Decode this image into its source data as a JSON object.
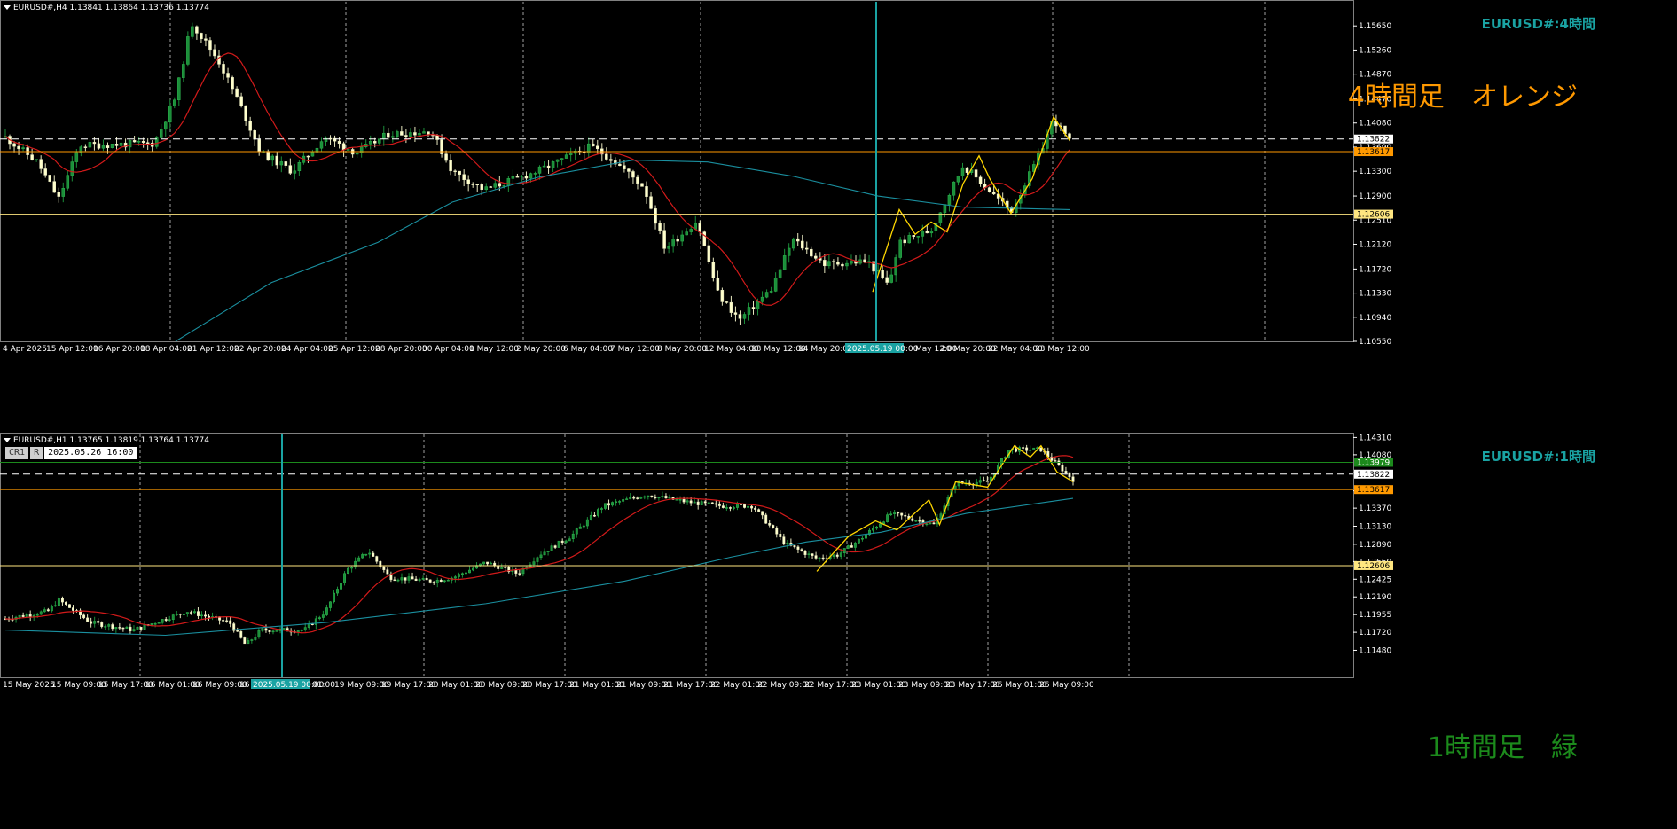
{
  "top": {
    "header": "EURUSD#,H4  1.13841 1.13864 1.13736 1.13774",
    "title": "EURUSD#:4時間",
    "big_label": "4時間足　オレンジ",
    "price_min": 1.1055,
    "price_max": 1.1604,
    "price_ticks": [
      "1.15650",
      "1.15260",
      "1.14870",
      "1.14470",
      "1.14080",
      "1.13690",
      "1.13300",
      "1.12900",
      "1.12510",
      "1.12120",
      "1.11720",
      "1.11330",
      "1.10940",
      "1.10550"
    ],
    "tick_values": [
      1.1565,
      1.1526,
      1.1487,
      1.1447,
      1.1408,
      1.1369,
      1.133,
      1.129,
      1.1251,
      1.1212,
      1.1172,
      1.1133,
      1.1094,
      1.1055
    ],
    "time_labels": [
      "4 Apr 2025",
      "15 Apr 12:00",
      "16 Apr 20:00",
      "18 Apr 04:00",
      "21 Apr 12:00",
      "22 Apr 20:00",
      "24 Apr 04:00",
      "25 Apr 12:00",
      "28 Apr 20:00",
      "30 Apr 04:00",
      "1 May 12:00",
      "2 May 20:00",
      "6 May 04:00",
      "7 May 12:00",
      "8 May 20:00",
      "12 May 04:00",
      "13 May 12:00",
      "14 May 20:00",
      "2025.05.19 00:00",
      "May 12:00",
      "20 May 20:00",
      "22 May 04:00",
      "23 May 12:00"
    ],
    "crosshair_label": "2025.05.19 00:00",
    "hlines": [
      {
        "price": 1.13822,
        "label": "1.13822",
        "color": "#ffffff",
        "style": "dashed"
      },
      {
        "price": 1.13617,
        "label": "1.13617",
        "color": "#ff9900",
        "style": "solid"
      },
      {
        "price": 1.12606,
        "label": "1.12606",
        "color": "#ffe680",
        "style": "solid"
      }
    ]
  },
  "bottom": {
    "header": "EURUSD#,H1  1.13765 1.13819 1.13764 1.13774",
    "title": "EURUSD#:1時間",
    "big_label": "1時間足　緑",
    "crosshair_text": "2025.05.26 16:00",
    "cr_tag": "CR1",
    "cr_r": "R",
    "price_min": 1.1112,
    "price_max": 1.1435,
    "price_ticks": [
      "1.14310",
      "1.14080",
      "1.13840",
      "1.13600",
      "1.13370",
      "1.13130",
      "1.12890",
      "1.12660",
      "1.12425",
      "1.12190",
      "1.11955",
      "1.11720",
      "1.11480"
    ],
    "tick_values": [
      1.1431,
      1.1408,
      1.1384,
      1.136,
      1.1337,
      1.1313,
      1.1289,
      1.1266,
      1.12425,
      1.1219,
      1.11955,
      1.1172,
      1.1148
    ],
    "time_labels": [
      "15 May 2025",
      "15 May 09:00",
      "15 May 17:00",
      "16 May 01:00",
      "16 May 09:00",
      "16 M",
      "2025.05.19 00:00",
      "01:00",
      "19 May 09:00",
      "19 May 17:00",
      "20 May 01:00",
      "20 May 09:00",
      "20 May 17:00",
      "21 May 01:00",
      "21 May 09:00",
      "21 May 17:00",
      "22 May 01:00",
      "22 May 09:00",
      "22 May 17:00",
      "23 May 01:00",
      "23 May 09:00",
      "23 May 17:00",
      "26 May 01:00",
      "26 May 09:00"
    ],
    "crosshair_label": "2025.05.19 00:00",
    "hlines": [
      {
        "price": 1.13979,
        "label": "1.13979",
        "color": "#1c8a1c",
        "style": "solid"
      },
      {
        "price": 1.13822,
        "label": "1.13822",
        "color": "#ffffff",
        "style": "dashed"
      },
      {
        "price": 1.13617,
        "label": "1.13617",
        "color": "#ff9900",
        "style": "solid"
      },
      {
        "price": 1.12606,
        "label": "1.12606",
        "color": "#ffe680",
        "style": "solid"
      }
    ]
  },
  "colors": {
    "background": "#000000",
    "grid": "#c8c8c8",
    "bull": "#1b8f3a",
    "bear": "#ffffcc",
    "ma_fast": "#d11a1a",
    "ma_slow": "#1a8f9f",
    "zigzag": "#ffd700",
    "crosshair": "#1aa3a3",
    "orange": "#ff9900",
    "green": "#1c8a1c"
  }
}
